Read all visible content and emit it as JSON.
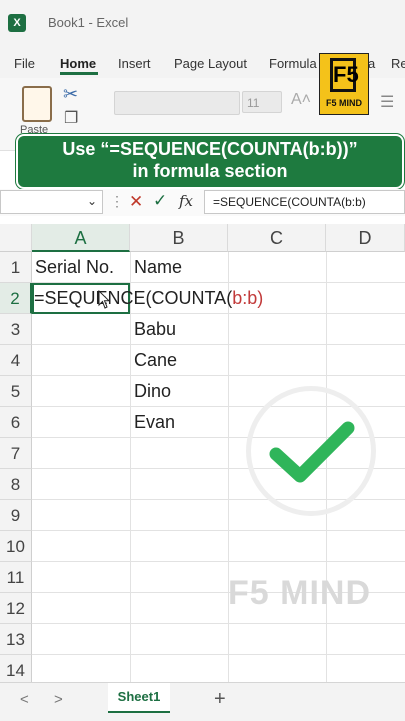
{
  "window": {
    "icon_letter": "X",
    "title": "Book1 - Excel"
  },
  "menu": {
    "items": [
      "File",
      "Home",
      "Insert",
      "Page Layout",
      "Formula",
      "a",
      "Re"
    ]
  },
  "ribbon": {
    "paste_label": "Paste",
    "font_size": "11"
  },
  "logo": {
    "mark": "F5",
    "text": "F5 MIND"
  },
  "banner": {
    "line1": "Use “=SEQUENCE(COUNTA(b:b))”",
    "line2": "in formula section"
  },
  "formula_bar": {
    "fx": "fx",
    "content": "=SEQUENCE(COUNTA(b:b)"
  },
  "columns": [
    "A",
    "B",
    "C",
    "D"
  ],
  "rows": [
    "1",
    "2",
    "3",
    "4",
    "5",
    "6",
    "7",
    "8",
    "9",
    "10",
    "11",
    "12",
    "13",
    "14"
  ],
  "cells": {
    "a1": "Serial No.",
    "b1": "Name",
    "b3": "Babu",
    "b4": "Cane",
    "b5": "Dino",
    "b6": "Evan"
  },
  "formula_cell": {
    "prefix": "=SEQUENCE(COUNTA(",
    "ref": "b:b)"
  },
  "watermark": {
    "text": "F5 MIND"
  },
  "sheet": {
    "tab": "Sheet1",
    "add": "+"
  },
  "colors": {
    "excel_green": "#1d6f42",
    "banner_green": "#1e7a3f",
    "check_green": "#2fb55a",
    "logo_yellow": "#f4c21a"
  }
}
